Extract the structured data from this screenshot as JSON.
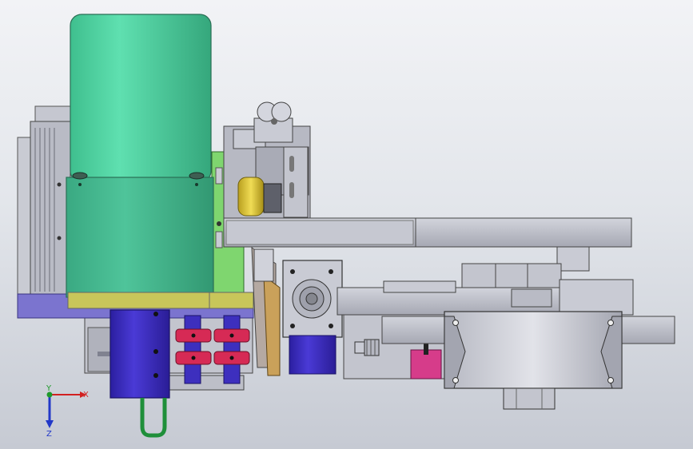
{
  "viewport": {
    "background_top": "#f2f3f6",
    "background_bottom": "#c6cad3"
  },
  "colors": {
    "motor_green": "#4fcf9f",
    "motor_body": "#45b98c",
    "base_plate": "#7b74cf",
    "cylinder_blue": "#3d2fbe",
    "clamp_red": "#d62a55",
    "magenta_block": "#d63c8a",
    "green_panel": "#7fd66f",
    "steel_light": "#c9cbd4",
    "steel_mid": "#a9abb6",
    "steel_dark": "#6f717c",
    "brass": "#d8c23a",
    "hose_green": "#1f8f3a"
  },
  "triad": {
    "x_label": "X",
    "y_label": "Y",
    "z_label": "Z",
    "x_color": "#d22020",
    "y_color": "#1f9a2c",
    "z_color": "#2238c8"
  }
}
